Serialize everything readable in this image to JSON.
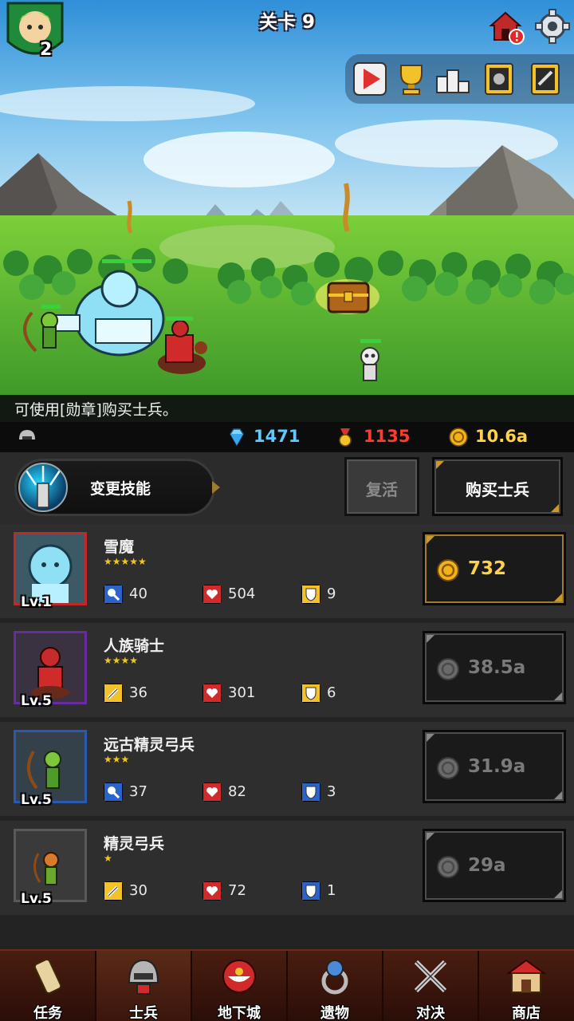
{
  "header": {
    "stage_title": "关卡 9",
    "hero_level": "2"
  },
  "top_icons": [
    "home-alert-icon",
    "gear-icon"
  ],
  "quick_bar": [
    "play-icon",
    "trophy-icon",
    "podium-icon",
    "book-icon",
    "scroll-icon"
  ],
  "tip": {
    "text": "可使用[勋章]购买士兵。"
  },
  "currency": {
    "diamond": {
      "icon": "diamond-icon",
      "value": "1471",
      "color": "#5ec8ff"
    },
    "medal": {
      "icon": "medal-icon",
      "value": "1135",
      "color": "#ff3b2f"
    },
    "gold": {
      "icon": "gold-coin-icon",
      "value": "10.6a",
      "color": "#ffd24a"
    }
  },
  "actions": {
    "skill_label": "变更技能",
    "revive_label": "复活",
    "buy_label": "购买士兵"
  },
  "soldiers": [
    {
      "name": "雪魔",
      "stars": "★★★★★",
      "level": "Lv.1",
      "frame_color": "#c0282a",
      "attack_icon": "magic-wand-icon",
      "attack": "40",
      "hp": "504",
      "defense_icon": "gold-shield-icon",
      "defense": "9",
      "price": "732",
      "price_color": "#ffd24a",
      "affordable": true
    },
    {
      "name": "人族骑士",
      "stars": "★★★★",
      "level": "Lv.5",
      "frame_color": "#6a2aa0",
      "attack_icon": "sword-icon",
      "attack": "36",
      "hp": "301",
      "defense_icon": "gold-shield-icon",
      "defense": "6",
      "price": "38.5a",
      "price_color": "#7a7a7a",
      "affordable": false
    },
    {
      "name": "远古精灵弓兵",
      "stars": "★★★",
      "level": "Lv.5",
      "frame_color": "#2a5ab0",
      "attack_icon": "magic-wand-icon",
      "attack": "37",
      "hp": "82",
      "defense_icon": "blue-shield-icon",
      "defense": "3",
      "price": "31.9a",
      "price_color": "#7a7a7a",
      "affordable": false
    },
    {
      "name": "精灵弓兵",
      "stars": "★",
      "level": "Lv.5",
      "frame_color": "#5a5a5a",
      "attack_icon": "sword-icon",
      "attack": "30",
      "hp": "72",
      "defense_icon": "blue-shield-icon",
      "defense": "1",
      "price": "29a",
      "price_color": "#7a7a7a",
      "affordable": false
    }
  ],
  "nav": [
    {
      "label": "任务",
      "icon": "scroll-icon"
    },
    {
      "label": "士兵",
      "icon": "helmet-icon",
      "active": true
    },
    {
      "label": "地下城",
      "icon": "monster-plant-icon"
    },
    {
      "label": "遗物",
      "icon": "ring-icon"
    },
    {
      "label": "对决",
      "icon": "crossed-swords-icon"
    },
    {
      "label": "商店",
      "icon": "shop-icon"
    }
  ]
}
